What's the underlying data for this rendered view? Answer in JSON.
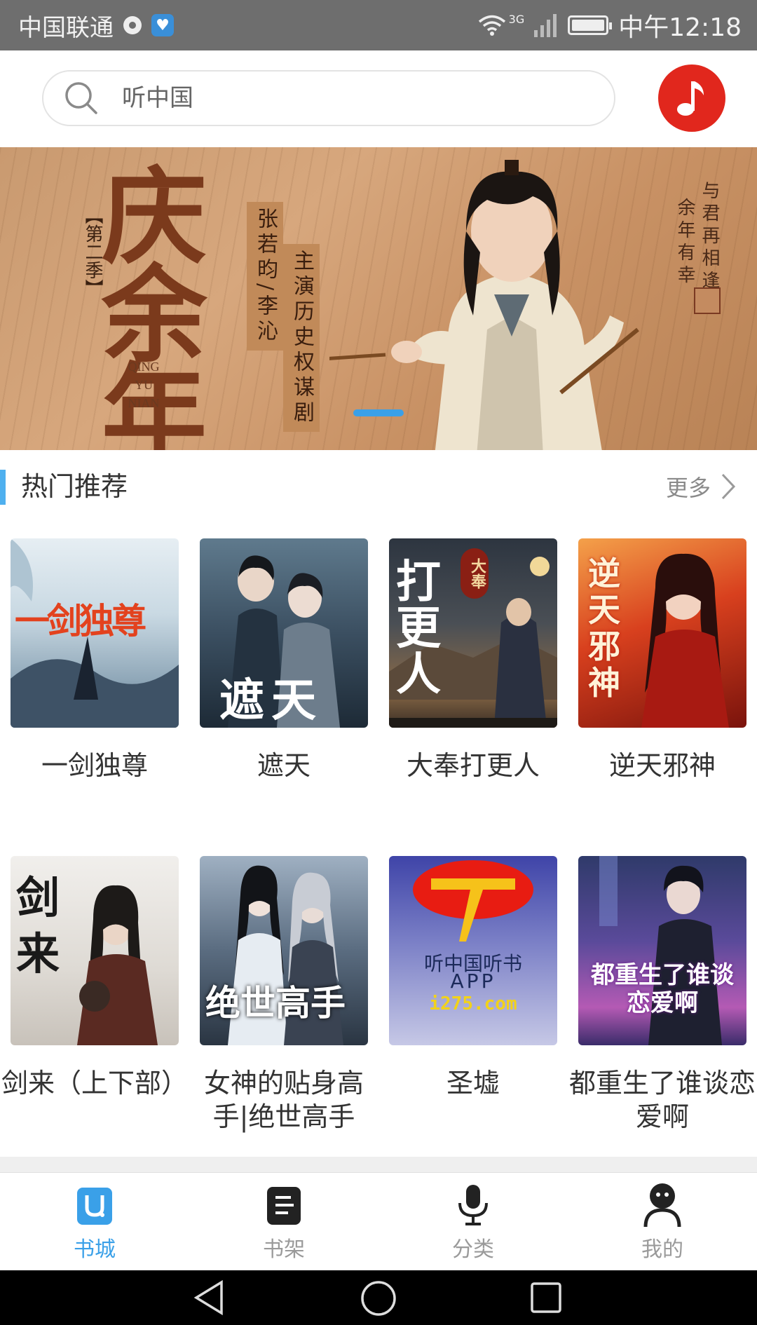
{
  "status_bar": {
    "carrier": "中国联通",
    "network": "3G",
    "time": "中午12:18"
  },
  "search": {
    "placeholder": "听中国"
  },
  "banner": {
    "title": "庆余年",
    "season": "【第二季】",
    "subtitle": "QING YU NIAN",
    "actors": "张若昀/李沁",
    "genre": "主演历史权谋剧",
    "slogan_line1": "与君再相逢",
    "slogan_line2": "余年有幸"
  },
  "section": {
    "title": "热门推荐",
    "more": "更多"
  },
  "books": [
    {
      "title": "一剑独尊",
      "cover_text": "一剑独尊"
    },
    {
      "title": "遮天",
      "cover_text": "遮天"
    },
    {
      "title": "大奉打更人",
      "cover_text": "打更人",
      "cover_badge": "大奉"
    },
    {
      "title": "逆天邪神",
      "cover_text": "逆天邪神"
    },
    {
      "title": "剑来（上下部）",
      "cover_text": "剑来"
    },
    {
      "title": "女神的贴身高手|绝世高手",
      "cover_text": "绝世高手"
    },
    {
      "title": "圣墟",
      "cover_line1": "听中国听书",
      "cover_line2": "APP",
      "cover_line3": "i275.com"
    },
    {
      "title": "都重生了谁谈恋爱啊",
      "cover_text": "都重生了谁谈恋爱啊"
    }
  ],
  "nav": {
    "items": [
      {
        "label": "书城",
        "icon": "bookstore-icon",
        "active": true
      },
      {
        "label": "书架",
        "icon": "bookshelf-icon",
        "active": false
      },
      {
        "label": "分类",
        "icon": "microphone-icon",
        "active": false
      },
      {
        "label": "我的",
        "icon": "profile-icon",
        "active": false
      }
    ]
  },
  "colors": {
    "accent": "#3aa0e8",
    "music_button": "#e1271d"
  }
}
